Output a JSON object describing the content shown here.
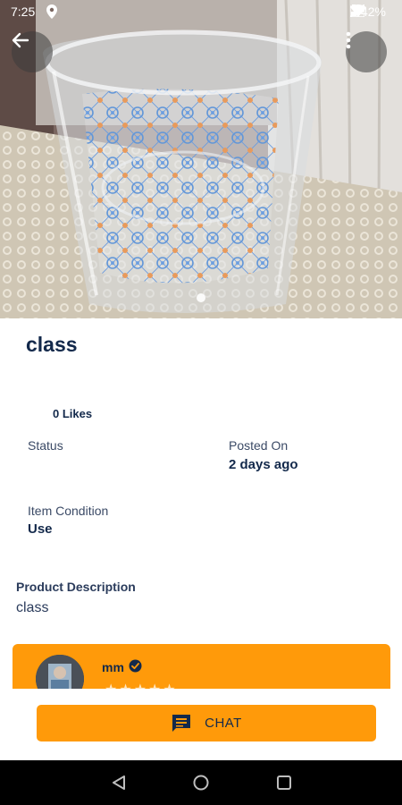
{
  "status_bar": {
    "time": "7:25",
    "battery": "42%",
    "icons": [
      "location-icon",
      "wifi-icon",
      "signal-icon",
      "battery-icon"
    ]
  },
  "header": {
    "back_icon": "arrow-left-icon",
    "more_icon": "more-vertical-icon"
  },
  "product": {
    "title": "class",
    "likes": "0 Likes",
    "status_label": "Status",
    "status_value": "",
    "posted_on_label": "Posted On",
    "posted_on_value": "2 days ago",
    "condition_label": "Item Condition",
    "condition_value": "Use",
    "description_heading": "Product Description",
    "description_text": "class"
  },
  "seller": {
    "name": "mm",
    "verified_icon": "verified-badge-icon",
    "rating": 0
  },
  "chat_button": {
    "label": "CHAT",
    "icon": "chat-bubble-icon"
  },
  "colors": {
    "accent": "#ff9a0a",
    "text_primary": "#13294b",
    "navbar": "#000000"
  },
  "nav": {
    "icons": [
      "back-triangle-icon",
      "home-circle-icon",
      "recents-square-icon"
    ]
  }
}
